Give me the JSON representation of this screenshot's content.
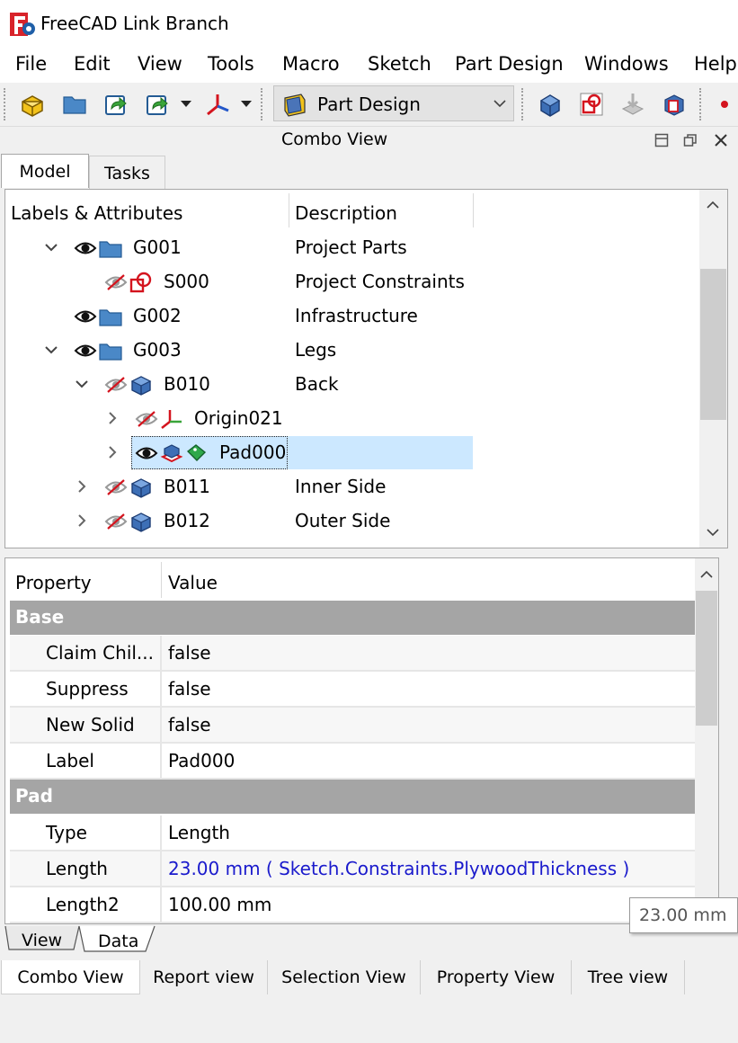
{
  "window": {
    "title": "FreeCAD Link Branch"
  },
  "menu": [
    "File",
    "Edit",
    "View",
    "Tools",
    "Macro",
    "Sketch",
    "Part Design",
    "Windows",
    "Help"
  ],
  "toolbar": {
    "workbench": "Part Design"
  },
  "combo_view": {
    "title": "Combo View",
    "tabs": [
      "Model",
      "Tasks"
    ],
    "active_tab": "Model"
  },
  "tree": {
    "columns": [
      "Labels & Attributes",
      "Description"
    ],
    "rows": [
      {
        "label": "G001",
        "description": "Project Parts",
        "icon": "folder-icon",
        "visible": true,
        "expanded": true
      },
      {
        "label": "S000",
        "description": "Project Constraints",
        "icon": "spreadsheet-constraint-icon",
        "visible": false
      },
      {
        "label": "G002",
        "description": "Infrastructure",
        "icon": "folder-icon",
        "visible": true
      },
      {
        "label": "G003",
        "description": "Legs",
        "icon": "folder-icon",
        "visible": true,
        "expanded": true
      },
      {
        "label": "B010",
        "description": "Back",
        "icon": "body-icon",
        "visible": false,
        "expanded": true
      },
      {
        "label": "Origin021",
        "description": "",
        "icon": "origin-icon",
        "visible": false
      },
      {
        "label": "Pad000",
        "description": "",
        "icon": "pad-icon",
        "visible": true,
        "selected": true
      },
      {
        "label": "B011",
        "description": "Inner Side",
        "icon": "body-icon",
        "visible": false
      },
      {
        "label": "B012",
        "description": "Outer Side",
        "icon": "body-icon",
        "visible": false
      }
    ]
  },
  "properties": {
    "columns": [
      "Property",
      "Value"
    ],
    "groups": [
      {
        "name": "Base",
        "rows": [
          {
            "name": "Claim Chil...",
            "value": "false"
          },
          {
            "name": "Suppress",
            "value": "false"
          },
          {
            "name": "New Solid",
            "value": "false"
          },
          {
            "name": "Label",
            "value": "Pad000"
          }
        ]
      },
      {
        "name": "Pad",
        "rows": [
          {
            "name": "Type",
            "value": "Length"
          },
          {
            "name": "Length",
            "value": "23.00 mm  ( Sketch.Constraints.PlywoodThickness )"
          },
          {
            "name": "Length2",
            "value": "100.00 mm"
          }
        ]
      }
    ],
    "tabs": [
      "View",
      "Data"
    ],
    "active_tab": "Data"
  },
  "tooltip": "23.00 mm",
  "bottom_tabs": [
    "Combo View",
    "Report view",
    "Selection View",
    "Property View",
    "Tree view"
  ],
  "colors": {
    "selection": "#cce8ff",
    "expression": "#1a1acc",
    "group_header": "#a5a5a5",
    "tree_red": "#d4141e",
    "part_blue": "#3d6fb6"
  }
}
